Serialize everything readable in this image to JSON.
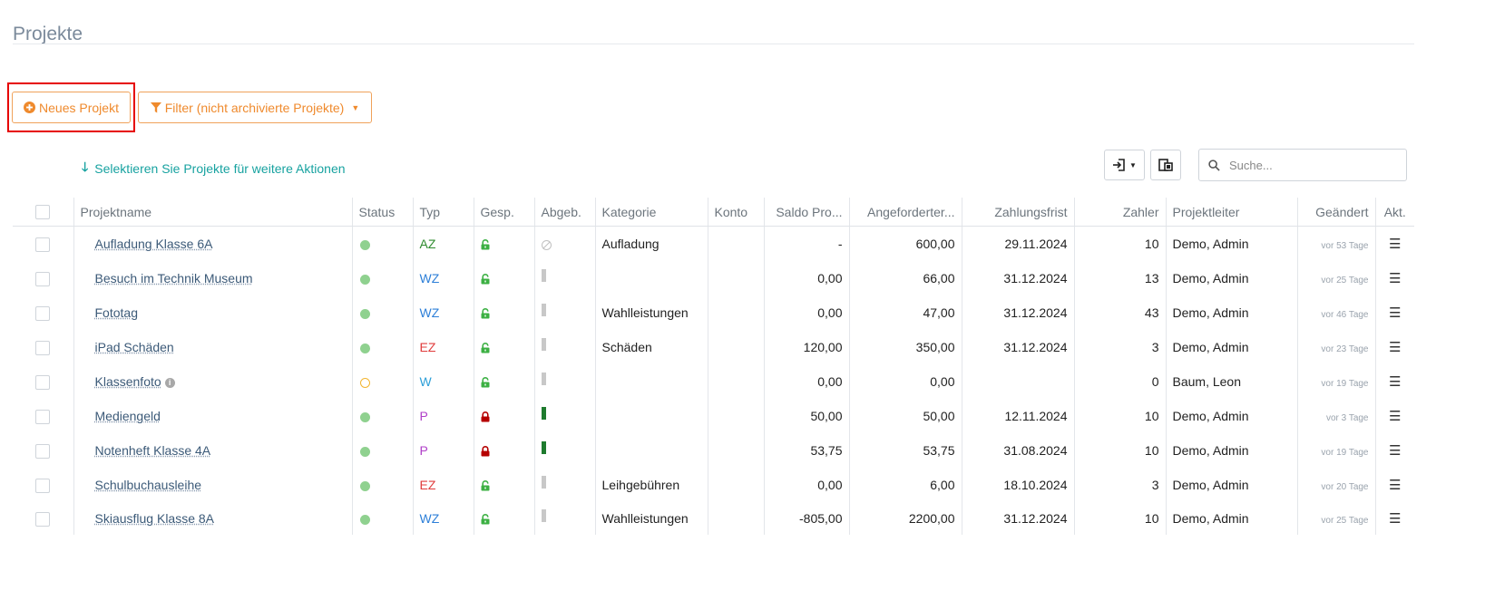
{
  "page": {
    "title": "Projekte"
  },
  "toolbar": {
    "new_project_label": "Neues Projekt",
    "filter_label": "Filter (nicht archivierte Projekte)",
    "select_hint": "Selektieren Sie Projekte für weitere Aktionen",
    "search_placeholder": "Suche..."
  },
  "colors": {
    "accent_orange": "#ef8a2d",
    "hint_teal": "#17a2a0",
    "highlight_red": "#e60000",
    "status_active": "#8fd18f",
    "status_pending": "#f2b531",
    "lock_open": "#3cb043",
    "lock_closed": "#b50000",
    "abg_done": "#1e7b2e",
    "abg_none": "#c8c8c8",
    "type_AZ": "#2e8b2e",
    "type_WZ": "#2d7fd8",
    "type_W": "#2d9fd8",
    "type_EZ": "#e03c3c",
    "type_P": "#b040c8"
  },
  "table": {
    "columns": [
      "Projektname",
      "Status",
      "Typ",
      "Gesp.",
      "Abgeb.",
      "Kategorie",
      "Konto",
      "Saldo Pro...",
      "Angeforderter...",
      "Zahlungsfrist",
      "Zahler",
      "Projektleiter",
      "Geändert",
      "Akt."
    ],
    "rows": [
      {
        "name": "Aufladung Klasse 6A",
        "info": false,
        "status": "active",
        "typ": "AZ",
        "locked": false,
        "abgeb": "none",
        "kategorie": "Aufladung",
        "konto": "",
        "saldo": "-",
        "angefordert": "600,00",
        "frist": "29.11.2024",
        "zahler": "10",
        "leiter": "Demo, Admin",
        "geaendert": "vor 53 Tage"
      },
      {
        "name": "Besuch im Technik Museum",
        "info": false,
        "status": "active",
        "typ": "WZ",
        "locked": false,
        "abgeb": "no",
        "kategorie": "",
        "konto": "",
        "saldo": "0,00",
        "angefordert": "66,00",
        "frist": "31.12.2024",
        "zahler": "13",
        "leiter": "Demo, Admin",
        "geaendert": "vor 25 Tage"
      },
      {
        "name": "Fototag",
        "info": false,
        "status": "active",
        "typ": "WZ",
        "locked": false,
        "abgeb": "no",
        "kategorie": "Wahlleistungen",
        "konto": "",
        "saldo": "0,00",
        "angefordert": "47,00",
        "frist": "31.12.2024",
        "zahler": "43",
        "leiter": "Demo, Admin",
        "geaendert": "vor 46 Tage"
      },
      {
        "name": "iPad Schäden",
        "info": false,
        "status": "active",
        "typ": "EZ",
        "locked": false,
        "abgeb": "no",
        "kategorie": "Schäden",
        "konto": "",
        "saldo": "120,00",
        "angefordert": "350,00",
        "frist": "31.12.2024",
        "zahler": "3",
        "leiter": "Demo, Admin",
        "geaendert": "vor 23 Tage"
      },
      {
        "name": "Klassenfoto",
        "info": true,
        "status": "pending",
        "typ": "W",
        "locked": false,
        "abgeb": "no",
        "kategorie": "",
        "konto": "",
        "saldo": "0,00",
        "angefordert": "0,00",
        "frist": "",
        "zahler": "0",
        "leiter": "Baum, Leon",
        "geaendert": "vor 19 Tage"
      },
      {
        "name": "Mediengeld",
        "info": false,
        "status": "active",
        "typ": "P",
        "locked": true,
        "abgeb": "yes",
        "kategorie": "",
        "konto": "",
        "saldo": "50,00",
        "angefordert": "50,00",
        "frist": "12.11.2024",
        "zahler": "10",
        "leiter": "Demo, Admin",
        "geaendert": "vor 3 Tage"
      },
      {
        "name": "Notenheft Klasse 4A",
        "info": false,
        "status": "active",
        "typ": "P",
        "locked": true,
        "abgeb": "yes",
        "kategorie": "",
        "konto": "",
        "saldo": "53,75",
        "angefordert": "53,75",
        "frist": "31.08.2024",
        "zahler": "10",
        "leiter": "Demo, Admin",
        "geaendert": "vor 19 Tage"
      },
      {
        "name": "Schulbuchausleihe",
        "info": false,
        "status": "active",
        "typ": "EZ",
        "locked": false,
        "abgeb": "no",
        "kategorie": "Leihgebühren",
        "konto": "",
        "saldo": "0,00",
        "angefordert": "6,00",
        "frist": "18.10.2024",
        "zahler": "3",
        "leiter": "Demo, Admin",
        "geaendert": "vor 20 Tage"
      },
      {
        "name": "Skiausflug Klasse 8A",
        "info": false,
        "status": "active",
        "typ": "WZ",
        "locked": false,
        "abgeb": "no",
        "kategorie": "Wahlleistungen",
        "konto": "",
        "saldo": "-805,00",
        "angefordert": "2200,00",
        "frist": "31.12.2024",
        "zahler": "10",
        "leiter": "Demo, Admin",
        "geaendert": "vor 25 Tage"
      }
    ]
  }
}
